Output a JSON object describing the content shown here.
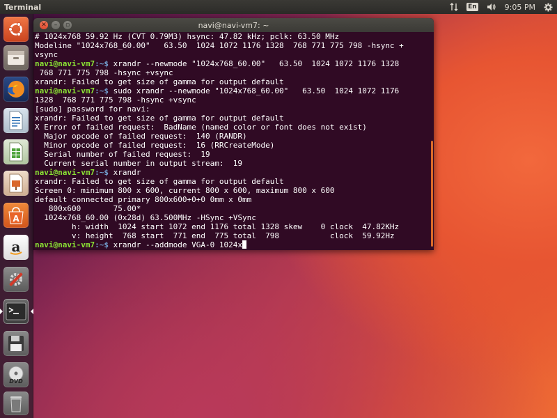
{
  "top_panel": {
    "app_title": "Terminal",
    "keyboard_layout": "En",
    "clock": "9:05 PM",
    "icons": [
      "network-icon",
      "keyboard-icon",
      "volume-icon",
      "power-gear-icon"
    ]
  },
  "launcher": {
    "items": [
      {
        "name": "ubuntu-dash",
        "icon": "ubuntu-logo-icon"
      },
      {
        "name": "files",
        "icon": "file-cabinet-icon"
      },
      {
        "name": "firefox",
        "icon": "firefox-icon"
      },
      {
        "name": "libreoffice-writer",
        "icon": "writer-document-icon"
      },
      {
        "name": "libreoffice-calc",
        "icon": "calc-spreadsheet-icon"
      },
      {
        "name": "libreoffice-impress",
        "icon": "impress-presentation-icon"
      },
      {
        "name": "ubuntu-software",
        "icon": "software-bag-icon"
      },
      {
        "name": "amazon",
        "icon": "amazon-icon"
      },
      {
        "name": "system-settings",
        "icon": "settings-tools-icon"
      },
      {
        "name": "terminal",
        "icon": "terminal-icon"
      },
      {
        "name": "floppy-drive",
        "icon": "floppy-icon"
      },
      {
        "name": "dvd-drive",
        "icon": "dvd-icon"
      },
      {
        "name": "trash",
        "icon": "trash-icon"
      }
    ]
  },
  "terminal": {
    "title": "navi@navi-vm7: ~",
    "prompt_user": "navi@navi-vm7",
    "prompt_path": ":~$",
    "lines": [
      {
        "type": "out",
        "text": "# 1024x768 59.92 Hz (CVT 0.79M3) hsync: 47.82 kHz; pclk: 63.50 MHz"
      },
      {
        "type": "out",
        "text": "Modeline \"1024x768_60.00\"   63.50  1024 1072 1176 1328  768 771 775 798 -hsync +"
      },
      {
        "type": "out",
        "text": "vsync"
      },
      {
        "type": "cmd",
        "text": " xrandr --newmode \"1024x768_60.00\"   63.50  1024 1072 1176 1328"
      },
      {
        "type": "out",
        "text": " 768 771 775 798 -hsync +vsync"
      },
      {
        "type": "out",
        "text": "xrandr: Failed to get size of gamma for output default"
      },
      {
        "type": "cmd",
        "text": " sudo xrandr --newmode \"1024x768_60.00\"   63.50  1024 1072 1176"
      },
      {
        "type": "out",
        "text": "1328  768 771 775 798 -hsync +vsync"
      },
      {
        "type": "out",
        "text": "[sudo] password for navi:"
      },
      {
        "type": "out",
        "text": "xrandr: Failed to get size of gamma for output default"
      },
      {
        "type": "out",
        "text": "X Error of failed request:  BadName (named color or font does not exist)"
      },
      {
        "type": "out",
        "text": "  Major opcode of failed request:  140 (RANDR)"
      },
      {
        "type": "out",
        "text": "  Minor opcode of failed request:  16 (RRCreateMode)"
      },
      {
        "type": "out",
        "text": "  Serial number of failed request:  19"
      },
      {
        "type": "out",
        "text": "  Current serial number in output stream:  19"
      },
      {
        "type": "cmd",
        "text": " xrandr"
      },
      {
        "type": "out",
        "text": "xrandr: Failed to get size of gamma for output default"
      },
      {
        "type": "out",
        "text": "Screen 0: minimum 800 x 600, current 800 x 600, maximum 800 x 600"
      },
      {
        "type": "out",
        "text": "default connected primary 800x600+0+0 0mm x 0mm"
      },
      {
        "type": "out",
        "text": "   800x600       75.00*"
      },
      {
        "type": "out",
        "text": "  1024x768_60.00 (0x28d) 63.500MHz -HSync +VSync"
      },
      {
        "type": "out",
        "text": "        h: width  1024 start 1072 end 1176 total 1328 skew    0 clock  47.82KHz"
      },
      {
        "type": "out",
        "text": "        v: height  768 start  771 end  775 total  798           clock  59.92Hz"
      },
      {
        "type": "cmd",
        "text": " xrandr --addmode VGA-0 1024x",
        "cursor": true
      }
    ]
  },
  "colors": {
    "terminal_bg": "#300a24",
    "prompt_user": "#8ae234",
    "prompt_path": "#729fcf",
    "accent_orange": "#e95420"
  }
}
